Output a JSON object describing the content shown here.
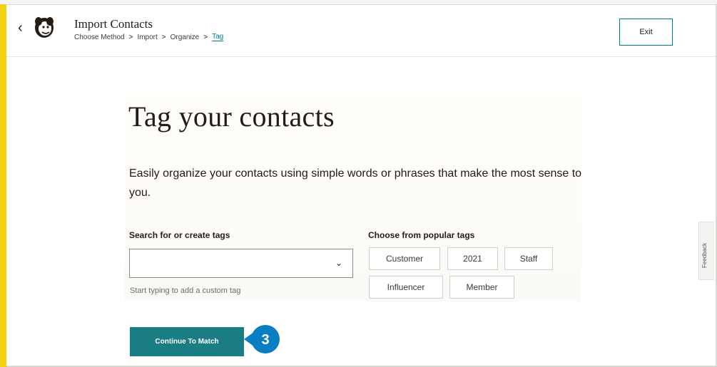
{
  "header": {
    "title": "Import Contacts",
    "breadcrumb": [
      "Choose Method",
      "Import",
      "Organize",
      "Tag"
    ],
    "breadcrumb_separator": ">",
    "back_icon": "‹",
    "exit_label": "Exit"
  },
  "main": {
    "heading": "Tag your contacts",
    "description": "Easily organize your contacts using simple words or phrases that make the most sense to you.",
    "search_label": "Search for or create tags",
    "search_value": "",
    "helper_text": "Start typing to add a custom tag",
    "popular_label": "Choose from popular tags",
    "popular_tags": [
      "Customer",
      "2021",
      "Staff",
      "Influencer",
      "Member"
    ],
    "continue_label": "Continue To Match"
  },
  "annotation": {
    "step_number": "3",
    "color": "#0a7ec2"
  },
  "feedback_label": "Feedback",
  "colors": {
    "accent": "#007c89",
    "button": "#1a7d83",
    "left_bar": "#f2d410"
  }
}
